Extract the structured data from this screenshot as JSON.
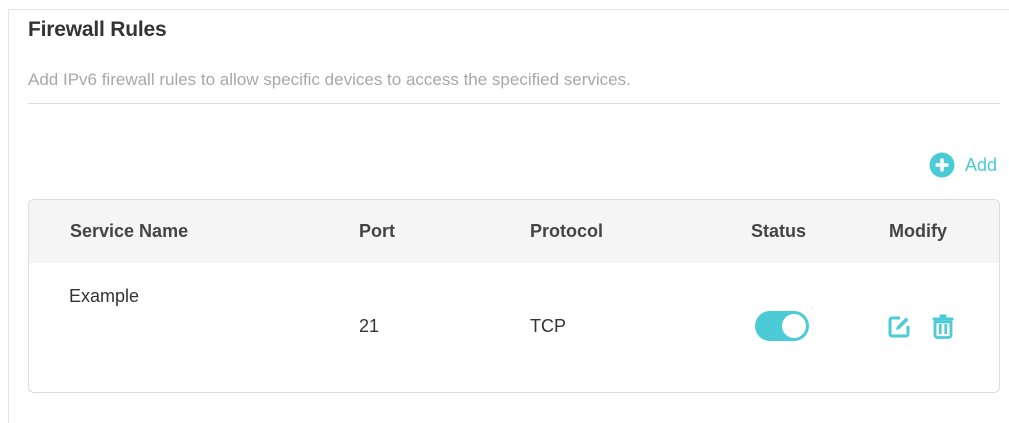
{
  "header": {
    "title": "Firewall Rules",
    "description": "Add IPv6 firewall rules to allow specific devices to access the specified services."
  },
  "toolbar": {
    "add_label": "Add",
    "add_icon": "plus-circle-icon"
  },
  "table": {
    "columns": [
      "Service Name",
      "Port",
      "Protocol",
      "Status",
      "Modify"
    ],
    "rows": [
      {
        "service_name": "Example",
        "port": "21",
        "protocol": "TCP",
        "status": "on",
        "modify_icons": [
          "edit-icon",
          "trash-icon"
        ]
      }
    ]
  },
  "colors": {
    "accent": "#4acbd6",
    "title": "#333333",
    "muted_text": "#a8a8a8",
    "header_bg": "#f5f5f5",
    "border": "#dcdcdc"
  }
}
